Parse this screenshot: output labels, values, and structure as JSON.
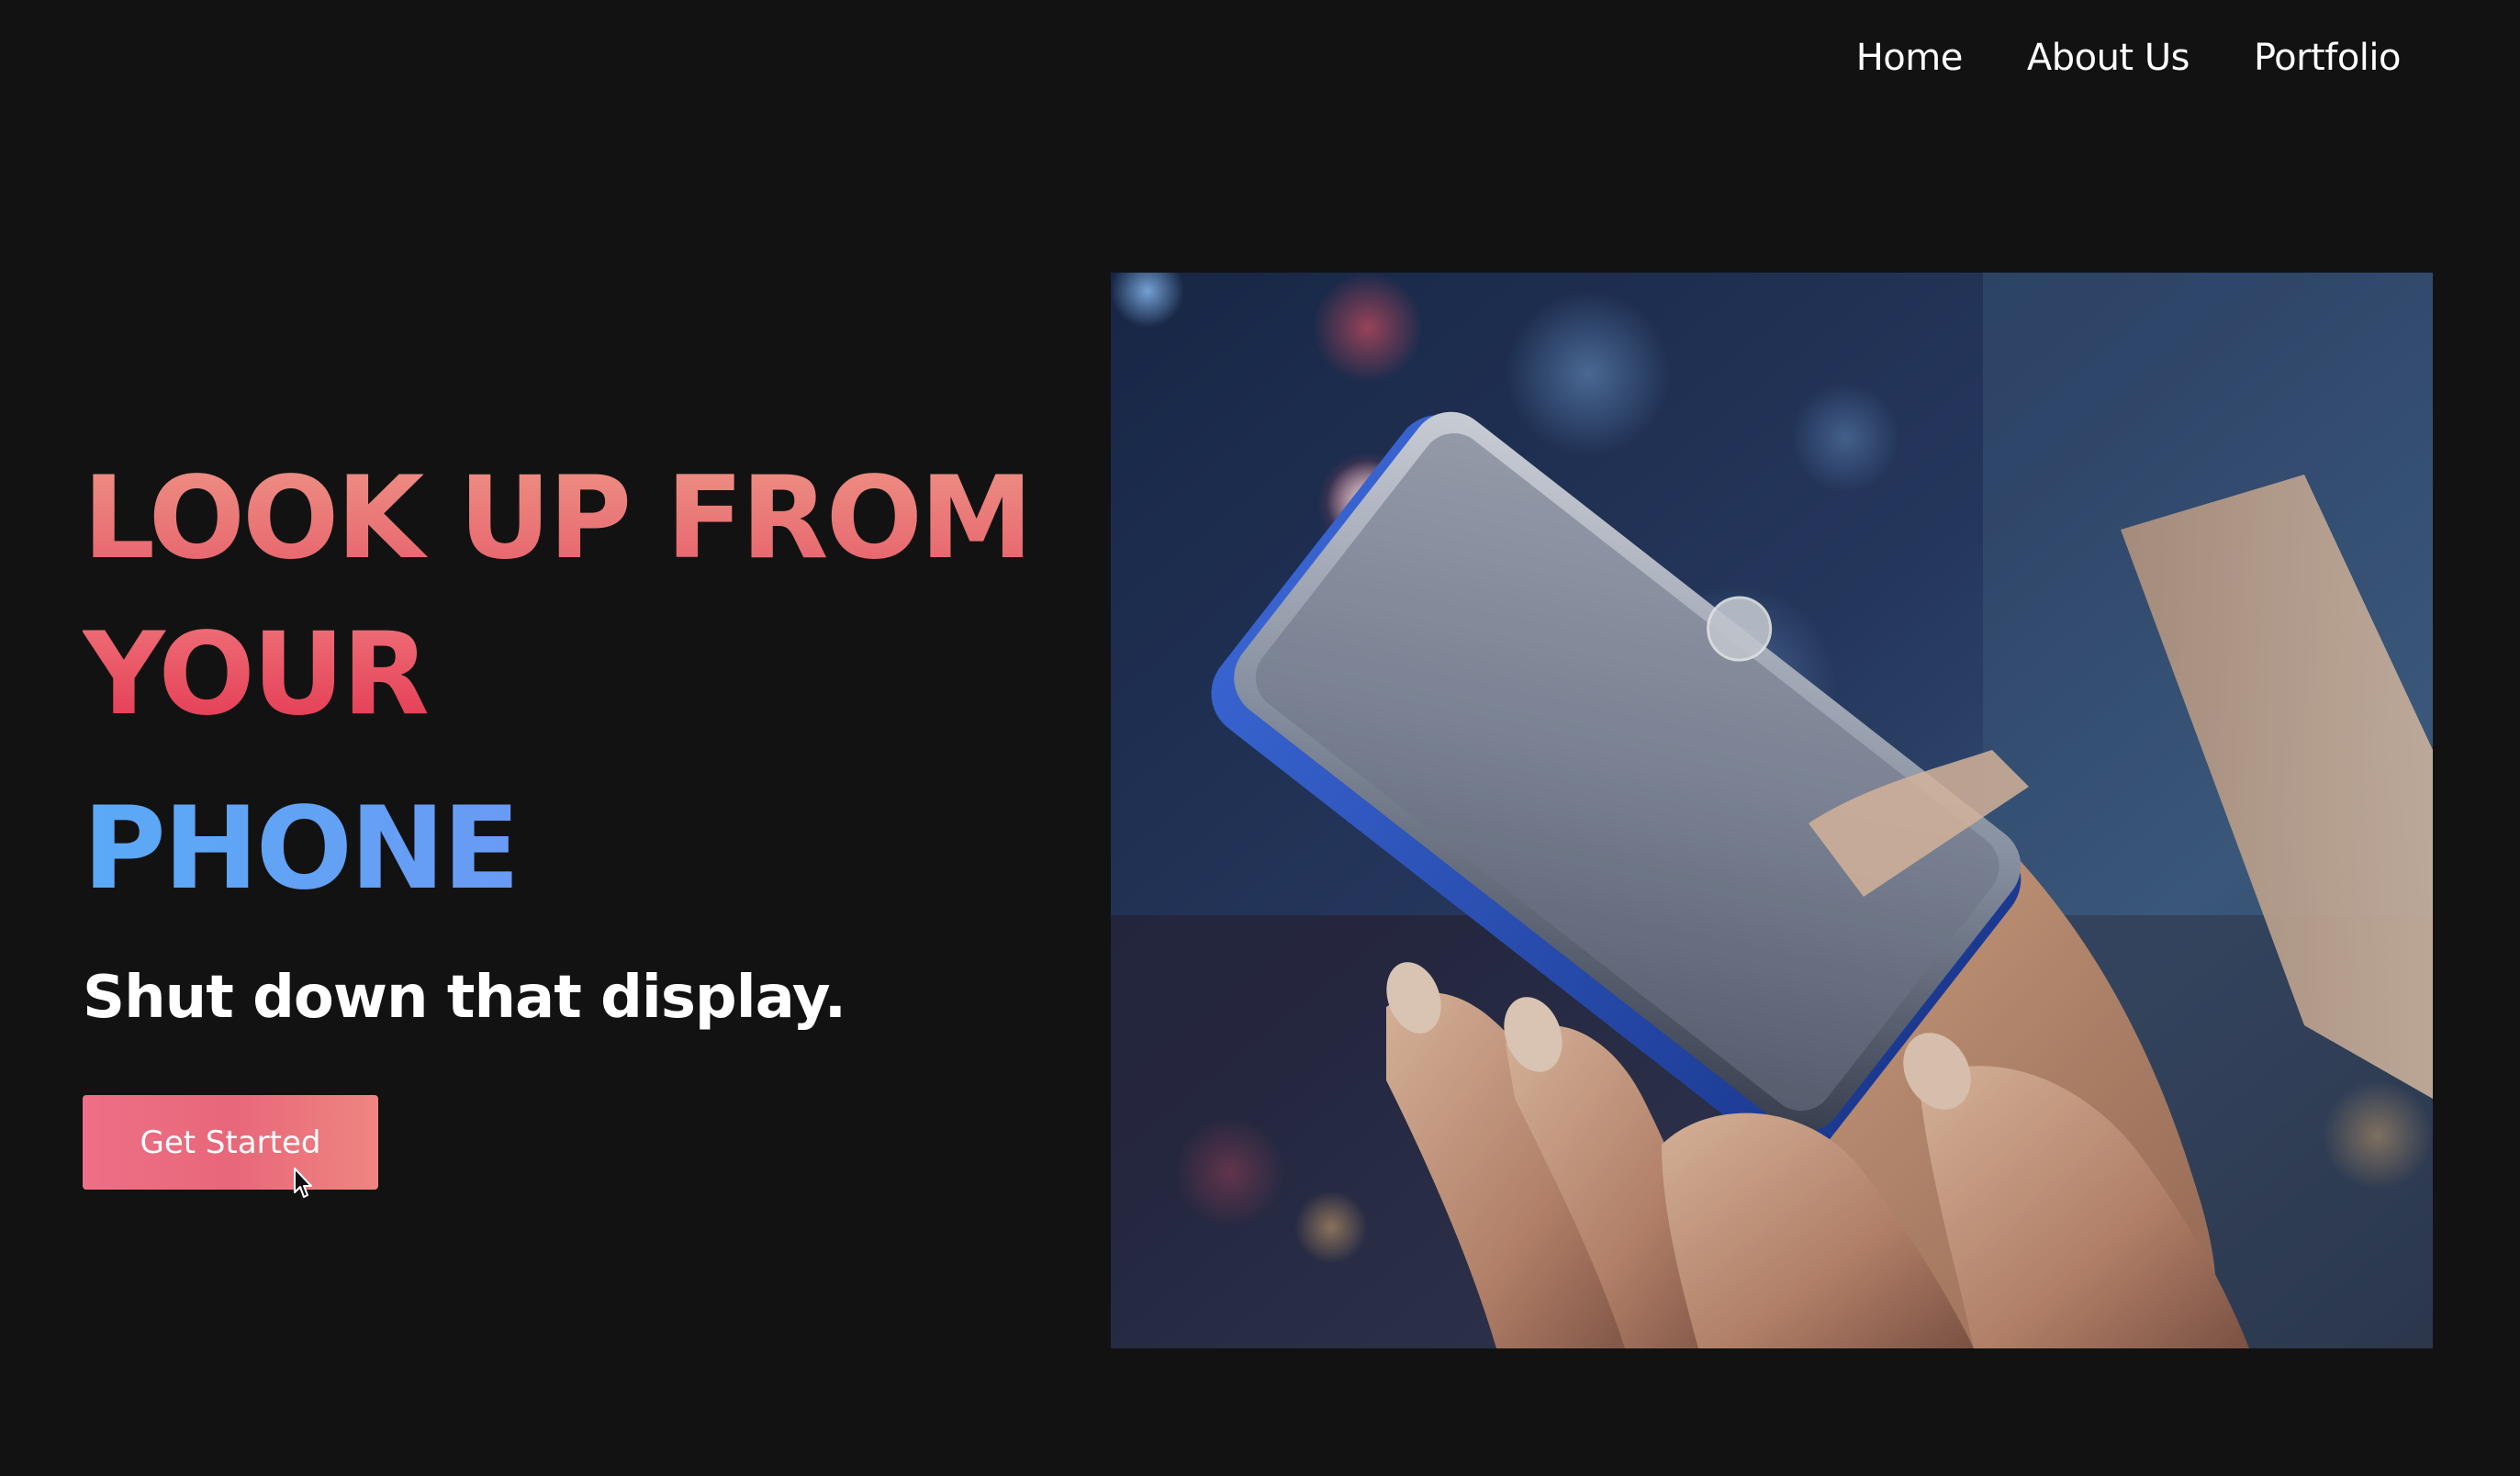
{
  "nav": {
    "items": [
      "Home",
      "About Us",
      "Portfolio"
    ]
  },
  "hero": {
    "headline_line_1": "LOOK UP FROM",
    "headline_line_2": "YOUR",
    "headline_line_3": "PHONE",
    "subheadline": "Shut down that display.",
    "cta_label": "Get Started"
  },
  "colors": {
    "background": "#121212",
    "headline_warm": "#e65a68",
    "headline_cool": "#6f9af4",
    "cta": "#ec6b82"
  }
}
